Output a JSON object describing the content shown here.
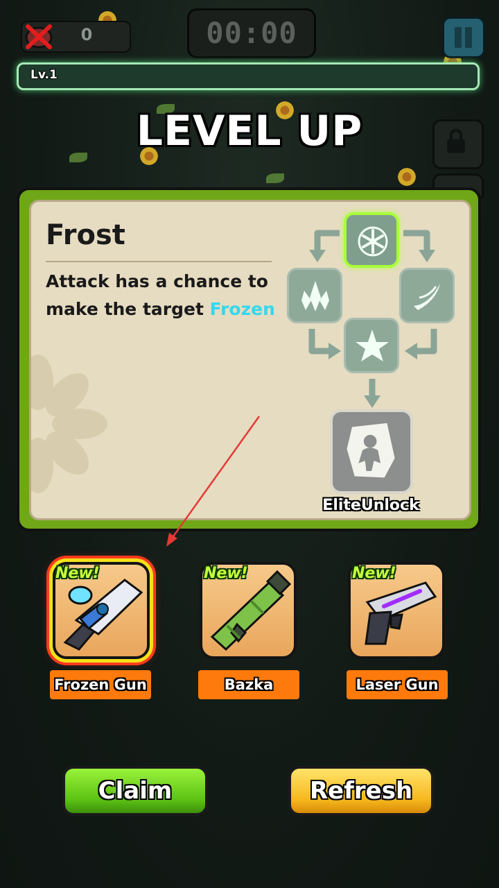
{
  "hud": {
    "kill_count": "0",
    "timer": "00:00",
    "level_label": "Lv.1"
  },
  "title": "LEVEL UP",
  "skill": {
    "name": "Frost",
    "description_prefix": "Attack has a chance to make the target ",
    "description_highlight": "Frozen",
    "elite_label": "EliteUnlock"
  },
  "weapons": [
    {
      "name": "Frozen Gun",
      "badge": "New!",
      "selected": true
    },
    {
      "name": "Bazka",
      "badge": "New!",
      "selected": false
    },
    {
      "name": "Laser Gun",
      "badge": "New!",
      "selected": false
    }
  ],
  "buttons": {
    "claim": "Claim",
    "refresh": "Refresh"
  },
  "colors": {
    "highlight": "#35d7ee",
    "panel_border": "#6fa718",
    "label_bg": "#ff7a0c",
    "selected_glow": "#ff3b1e"
  }
}
